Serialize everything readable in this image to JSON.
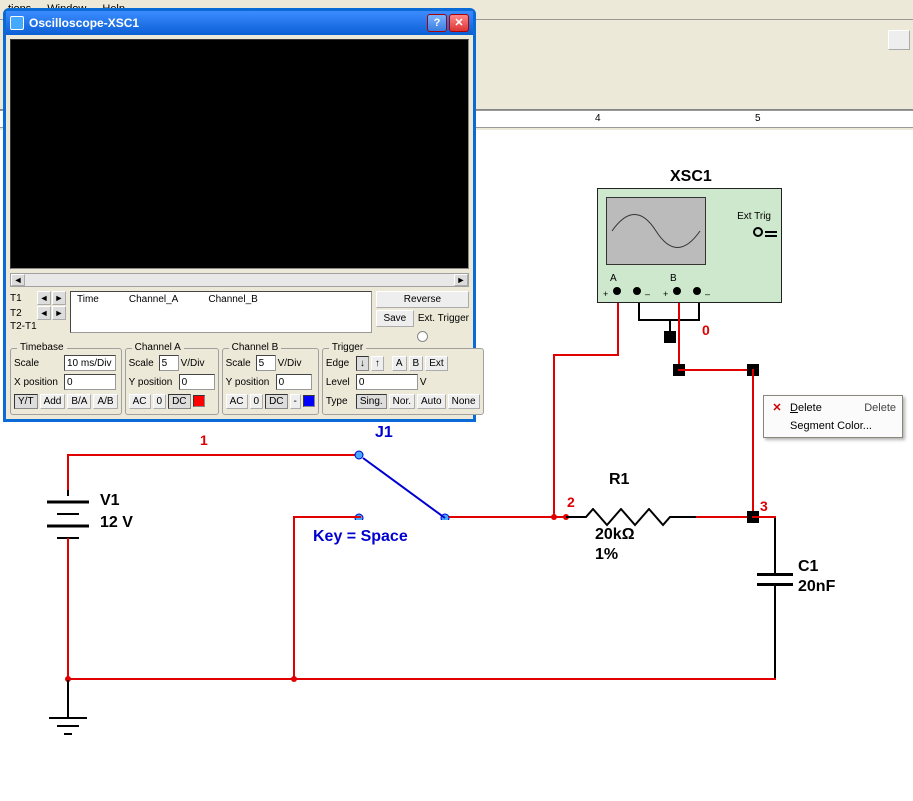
{
  "menubar": {
    "items": [
      "tions",
      "Window",
      "Help"
    ]
  },
  "ruler": {
    "marks": [
      {
        "pos": 595,
        "label": "4"
      },
      {
        "pos": 755,
        "label": "5"
      }
    ]
  },
  "osc": {
    "title": "Oscilloscope-XSC1",
    "cursors": {
      "t1": "T1",
      "t2": "T2",
      "diff": "T2-T1"
    },
    "table_headers": {
      "time": "Time",
      "cha": "Channel_A",
      "chb": "Channel_B"
    },
    "btns": {
      "reverse": "Reverse",
      "save": "Save",
      "ext_trig": "Ext. Trigger"
    },
    "timebase": {
      "legend": "Timebase",
      "scale_label": "Scale",
      "scale_value": "10 ms/Div",
      "xpos_label": "X position",
      "xpos_value": "0",
      "modes": [
        "Y/T",
        "Add",
        "B/A",
        "A/B"
      ]
    },
    "chanA": {
      "legend": "Channel A",
      "scale_label": "Scale",
      "scale_value": "5",
      "scale_unit": "V/Div",
      "ypos_label": "Y position",
      "ypos_value": "0",
      "modes": [
        "AC",
        "0",
        "DC"
      ],
      "color": "#ff0000"
    },
    "chanB": {
      "legend": "Channel B",
      "scale_label": "Scale",
      "scale_value": "5",
      "scale_unit": "V/Div",
      "ypos_label": "Y position",
      "ypos_value": "0",
      "modes": [
        "AC",
        "0",
        "DC",
        "-"
      ],
      "color": "#0000ff"
    },
    "trigger": {
      "legend": "Trigger",
      "edge_label": "Edge",
      "edge_btns": [
        "↓",
        "↑"
      ],
      "src_btns": [
        "A",
        "B",
        "Ext"
      ],
      "level_label": "Level",
      "level_value": "0",
      "level_unit": "V",
      "type_label": "Type",
      "type_btns": [
        "Sing.",
        "Nor.",
        "Auto",
        "None"
      ]
    }
  },
  "schematic": {
    "xsc_label": "XSC1",
    "ext_trig": "Ext Trig",
    "port_a": "A",
    "port_b": "B",
    "net1": "1",
    "net2": "2",
    "net3": "3",
    "net0": "0",
    "v1_name": "V1",
    "v1_value": "12 V",
    "j1_name": "J1",
    "j1_key": "Key = Space",
    "r1_name": "R1",
    "r1_value": "20kΩ",
    "r1_tol": "1%",
    "c1_name": "C1",
    "c1_value": "20nF"
  },
  "context_menu": {
    "delete": "Delete",
    "delete_shortcut": "Delete",
    "segcolor": "Segment Color..."
  }
}
